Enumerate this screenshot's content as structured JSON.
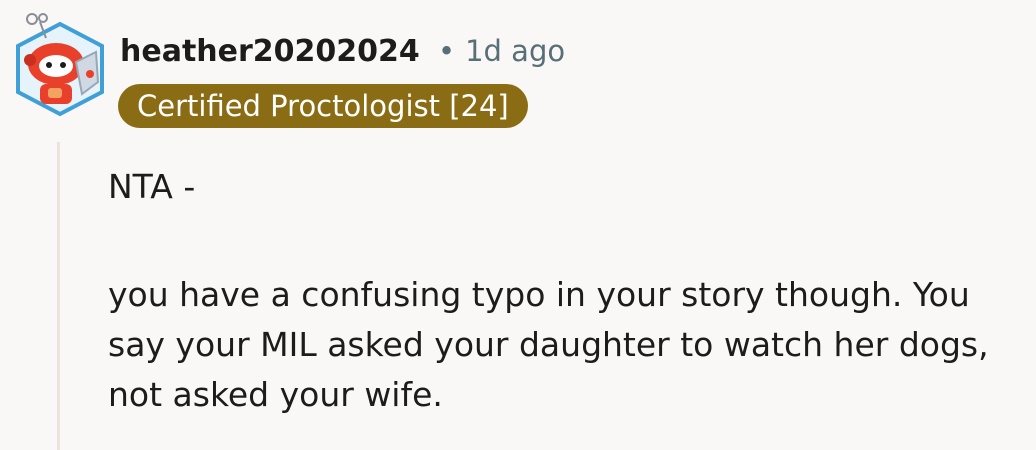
{
  "comment": {
    "author": "heather20202024",
    "separator": "•",
    "timestamp": "1d ago",
    "flair": "Certified Proctologist [24]",
    "body": {
      "paragraph_1": "NTA -",
      "paragraph_2": "you have a confusing typo in your story though. You say your MIL asked your daughter to watch her dogs, not asked your wife."
    }
  },
  "colors": {
    "background": "#faf8f6",
    "flair_background": "#8a6c14",
    "flair_text": "#ffffff",
    "meta_text": "#576f76",
    "thread_line": "#ebe3dc",
    "avatar_primary": "#e8402a",
    "avatar_border": "#3fa0d8"
  },
  "icons": {
    "avatar": "snoo-robot-avatar-icon"
  }
}
